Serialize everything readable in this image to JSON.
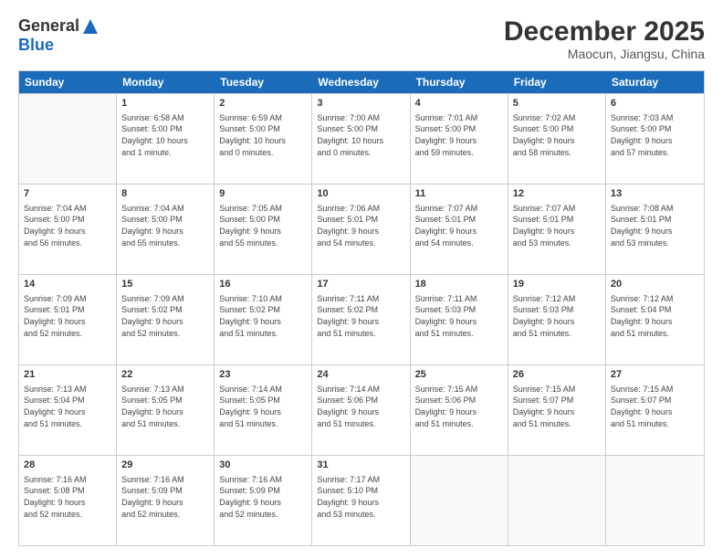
{
  "header": {
    "logo_general": "General",
    "logo_blue": "Blue",
    "month": "December 2025",
    "location": "Maocun, Jiangsu, China"
  },
  "weekdays": [
    "Sunday",
    "Monday",
    "Tuesday",
    "Wednesday",
    "Thursday",
    "Friday",
    "Saturday"
  ],
  "weeks": [
    [
      {
        "day": "",
        "info": ""
      },
      {
        "day": "1",
        "info": "Sunrise: 6:58 AM\nSunset: 5:00 PM\nDaylight: 10 hours\nand 1 minute."
      },
      {
        "day": "2",
        "info": "Sunrise: 6:59 AM\nSunset: 5:00 PM\nDaylight: 10 hours\nand 0 minutes."
      },
      {
        "day": "3",
        "info": "Sunrise: 7:00 AM\nSunset: 5:00 PM\nDaylight: 10 hours\nand 0 minutes."
      },
      {
        "day": "4",
        "info": "Sunrise: 7:01 AM\nSunset: 5:00 PM\nDaylight: 9 hours\nand 59 minutes."
      },
      {
        "day": "5",
        "info": "Sunrise: 7:02 AM\nSunset: 5:00 PM\nDaylight: 9 hours\nand 58 minutes."
      },
      {
        "day": "6",
        "info": "Sunrise: 7:03 AM\nSunset: 5:00 PM\nDaylight: 9 hours\nand 57 minutes."
      }
    ],
    [
      {
        "day": "7",
        "info": "Sunrise: 7:04 AM\nSunset: 5:00 PM\nDaylight: 9 hours\nand 56 minutes."
      },
      {
        "day": "8",
        "info": "Sunrise: 7:04 AM\nSunset: 5:00 PM\nDaylight: 9 hours\nand 55 minutes."
      },
      {
        "day": "9",
        "info": "Sunrise: 7:05 AM\nSunset: 5:00 PM\nDaylight: 9 hours\nand 55 minutes."
      },
      {
        "day": "10",
        "info": "Sunrise: 7:06 AM\nSunset: 5:01 PM\nDaylight: 9 hours\nand 54 minutes."
      },
      {
        "day": "11",
        "info": "Sunrise: 7:07 AM\nSunset: 5:01 PM\nDaylight: 9 hours\nand 54 minutes."
      },
      {
        "day": "12",
        "info": "Sunrise: 7:07 AM\nSunset: 5:01 PM\nDaylight: 9 hours\nand 53 minutes."
      },
      {
        "day": "13",
        "info": "Sunrise: 7:08 AM\nSunset: 5:01 PM\nDaylight: 9 hours\nand 53 minutes."
      }
    ],
    [
      {
        "day": "14",
        "info": "Sunrise: 7:09 AM\nSunset: 5:01 PM\nDaylight: 9 hours\nand 52 minutes."
      },
      {
        "day": "15",
        "info": "Sunrise: 7:09 AM\nSunset: 5:02 PM\nDaylight: 9 hours\nand 52 minutes."
      },
      {
        "day": "16",
        "info": "Sunrise: 7:10 AM\nSunset: 5:02 PM\nDaylight: 9 hours\nand 51 minutes."
      },
      {
        "day": "17",
        "info": "Sunrise: 7:11 AM\nSunset: 5:02 PM\nDaylight: 9 hours\nand 51 minutes."
      },
      {
        "day": "18",
        "info": "Sunrise: 7:11 AM\nSunset: 5:03 PM\nDaylight: 9 hours\nand 51 minutes."
      },
      {
        "day": "19",
        "info": "Sunrise: 7:12 AM\nSunset: 5:03 PM\nDaylight: 9 hours\nand 51 minutes."
      },
      {
        "day": "20",
        "info": "Sunrise: 7:12 AM\nSunset: 5:04 PM\nDaylight: 9 hours\nand 51 minutes."
      }
    ],
    [
      {
        "day": "21",
        "info": "Sunrise: 7:13 AM\nSunset: 5:04 PM\nDaylight: 9 hours\nand 51 minutes."
      },
      {
        "day": "22",
        "info": "Sunrise: 7:13 AM\nSunset: 5:05 PM\nDaylight: 9 hours\nand 51 minutes."
      },
      {
        "day": "23",
        "info": "Sunrise: 7:14 AM\nSunset: 5:05 PM\nDaylight: 9 hours\nand 51 minutes."
      },
      {
        "day": "24",
        "info": "Sunrise: 7:14 AM\nSunset: 5:06 PM\nDaylight: 9 hours\nand 51 minutes."
      },
      {
        "day": "25",
        "info": "Sunrise: 7:15 AM\nSunset: 5:06 PM\nDaylight: 9 hours\nand 51 minutes."
      },
      {
        "day": "26",
        "info": "Sunrise: 7:15 AM\nSunset: 5:07 PM\nDaylight: 9 hours\nand 51 minutes."
      },
      {
        "day": "27",
        "info": "Sunrise: 7:15 AM\nSunset: 5:07 PM\nDaylight: 9 hours\nand 51 minutes."
      }
    ],
    [
      {
        "day": "28",
        "info": "Sunrise: 7:16 AM\nSunset: 5:08 PM\nDaylight: 9 hours\nand 52 minutes."
      },
      {
        "day": "29",
        "info": "Sunrise: 7:16 AM\nSunset: 5:09 PM\nDaylight: 9 hours\nand 52 minutes."
      },
      {
        "day": "30",
        "info": "Sunrise: 7:16 AM\nSunset: 5:09 PM\nDaylight: 9 hours\nand 52 minutes."
      },
      {
        "day": "31",
        "info": "Sunrise: 7:17 AM\nSunset: 5:10 PM\nDaylight: 9 hours\nand 53 minutes."
      },
      {
        "day": "",
        "info": ""
      },
      {
        "day": "",
        "info": ""
      },
      {
        "day": "",
        "info": ""
      }
    ]
  ]
}
